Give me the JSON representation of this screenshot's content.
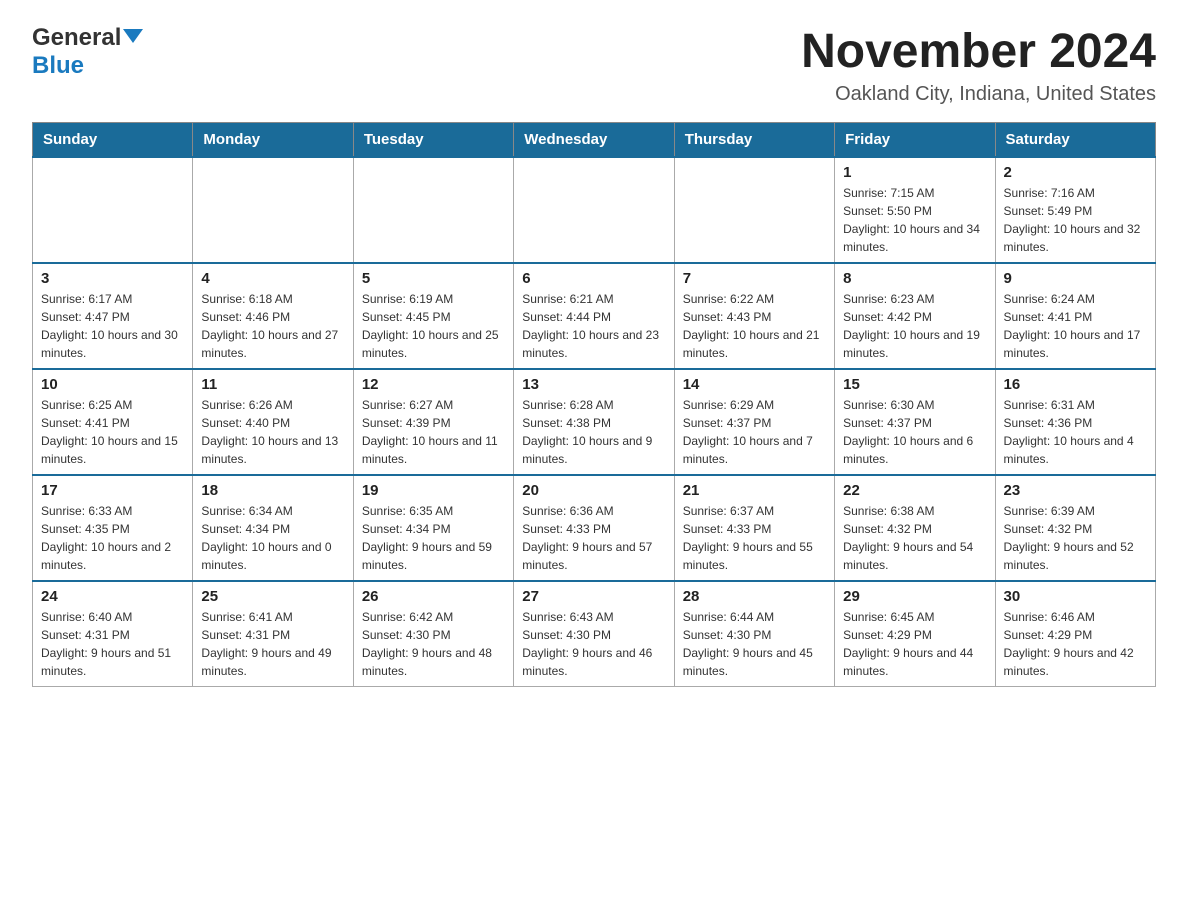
{
  "logo": {
    "general": "General",
    "blue": "Blue"
  },
  "title": "November 2024",
  "subtitle": "Oakland City, Indiana, United States",
  "days_of_week": [
    "Sunday",
    "Monday",
    "Tuesday",
    "Wednesday",
    "Thursday",
    "Friday",
    "Saturday"
  ],
  "weeks": [
    [
      {
        "day": "",
        "info": ""
      },
      {
        "day": "",
        "info": ""
      },
      {
        "day": "",
        "info": ""
      },
      {
        "day": "",
        "info": ""
      },
      {
        "day": "",
        "info": ""
      },
      {
        "day": "1",
        "info": "Sunrise: 7:15 AM\nSunset: 5:50 PM\nDaylight: 10 hours and 34 minutes."
      },
      {
        "day": "2",
        "info": "Sunrise: 7:16 AM\nSunset: 5:49 PM\nDaylight: 10 hours and 32 minutes."
      }
    ],
    [
      {
        "day": "3",
        "info": "Sunrise: 6:17 AM\nSunset: 4:47 PM\nDaylight: 10 hours and 30 minutes."
      },
      {
        "day": "4",
        "info": "Sunrise: 6:18 AM\nSunset: 4:46 PM\nDaylight: 10 hours and 27 minutes."
      },
      {
        "day": "5",
        "info": "Sunrise: 6:19 AM\nSunset: 4:45 PM\nDaylight: 10 hours and 25 minutes."
      },
      {
        "day": "6",
        "info": "Sunrise: 6:21 AM\nSunset: 4:44 PM\nDaylight: 10 hours and 23 minutes."
      },
      {
        "day": "7",
        "info": "Sunrise: 6:22 AM\nSunset: 4:43 PM\nDaylight: 10 hours and 21 minutes."
      },
      {
        "day": "8",
        "info": "Sunrise: 6:23 AM\nSunset: 4:42 PM\nDaylight: 10 hours and 19 minutes."
      },
      {
        "day": "9",
        "info": "Sunrise: 6:24 AM\nSunset: 4:41 PM\nDaylight: 10 hours and 17 minutes."
      }
    ],
    [
      {
        "day": "10",
        "info": "Sunrise: 6:25 AM\nSunset: 4:41 PM\nDaylight: 10 hours and 15 minutes."
      },
      {
        "day": "11",
        "info": "Sunrise: 6:26 AM\nSunset: 4:40 PM\nDaylight: 10 hours and 13 minutes."
      },
      {
        "day": "12",
        "info": "Sunrise: 6:27 AM\nSunset: 4:39 PM\nDaylight: 10 hours and 11 minutes."
      },
      {
        "day": "13",
        "info": "Sunrise: 6:28 AM\nSunset: 4:38 PM\nDaylight: 10 hours and 9 minutes."
      },
      {
        "day": "14",
        "info": "Sunrise: 6:29 AM\nSunset: 4:37 PM\nDaylight: 10 hours and 7 minutes."
      },
      {
        "day": "15",
        "info": "Sunrise: 6:30 AM\nSunset: 4:37 PM\nDaylight: 10 hours and 6 minutes."
      },
      {
        "day": "16",
        "info": "Sunrise: 6:31 AM\nSunset: 4:36 PM\nDaylight: 10 hours and 4 minutes."
      }
    ],
    [
      {
        "day": "17",
        "info": "Sunrise: 6:33 AM\nSunset: 4:35 PM\nDaylight: 10 hours and 2 minutes."
      },
      {
        "day": "18",
        "info": "Sunrise: 6:34 AM\nSunset: 4:34 PM\nDaylight: 10 hours and 0 minutes."
      },
      {
        "day": "19",
        "info": "Sunrise: 6:35 AM\nSunset: 4:34 PM\nDaylight: 9 hours and 59 minutes."
      },
      {
        "day": "20",
        "info": "Sunrise: 6:36 AM\nSunset: 4:33 PM\nDaylight: 9 hours and 57 minutes."
      },
      {
        "day": "21",
        "info": "Sunrise: 6:37 AM\nSunset: 4:33 PM\nDaylight: 9 hours and 55 minutes."
      },
      {
        "day": "22",
        "info": "Sunrise: 6:38 AM\nSunset: 4:32 PM\nDaylight: 9 hours and 54 minutes."
      },
      {
        "day": "23",
        "info": "Sunrise: 6:39 AM\nSunset: 4:32 PM\nDaylight: 9 hours and 52 minutes."
      }
    ],
    [
      {
        "day": "24",
        "info": "Sunrise: 6:40 AM\nSunset: 4:31 PM\nDaylight: 9 hours and 51 minutes."
      },
      {
        "day": "25",
        "info": "Sunrise: 6:41 AM\nSunset: 4:31 PM\nDaylight: 9 hours and 49 minutes."
      },
      {
        "day": "26",
        "info": "Sunrise: 6:42 AM\nSunset: 4:30 PM\nDaylight: 9 hours and 48 minutes."
      },
      {
        "day": "27",
        "info": "Sunrise: 6:43 AM\nSunset: 4:30 PM\nDaylight: 9 hours and 46 minutes."
      },
      {
        "day": "28",
        "info": "Sunrise: 6:44 AM\nSunset: 4:30 PM\nDaylight: 9 hours and 45 minutes."
      },
      {
        "day": "29",
        "info": "Sunrise: 6:45 AM\nSunset: 4:29 PM\nDaylight: 9 hours and 44 minutes."
      },
      {
        "day": "30",
        "info": "Sunrise: 6:46 AM\nSunset: 4:29 PM\nDaylight: 9 hours and 42 minutes."
      }
    ]
  ]
}
